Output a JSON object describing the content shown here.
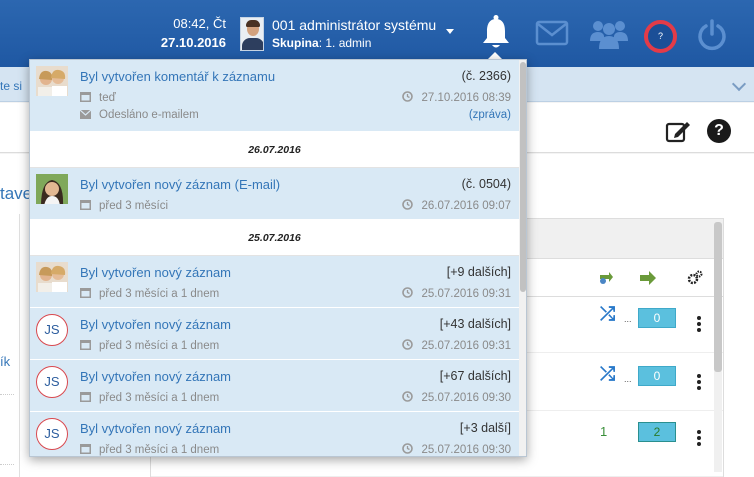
{
  "header": {
    "time": "08:42, Čt",
    "date": "27.10.2016",
    "user_name": "001 administrátor systému",
    "group_label": "Skupina",
    "group_value": ": 1. admin",
    "help_label": "?"
  },
  "subbar": {
    "text": "te si"
  },
  "toolbar": {
    "help_label": "?"
  },
  "content": {
    "heading": "tave",
    "left_link": "ík",
    "rows": [
      {
        "badge": "0",
        "count": ""
      },
      {
        "badge": "0",
        "count": ""
      },
      {
        "badge": "2",
        "count": "1"
      }
    ],
    "ellipsis": "..."
  },
  "notifications": {
    "first": {
      "title": "Byl vytvořen komentář k záznamu",
      "ref": "(č. 2366)",
      "when": "teď",
      "timestamp": "27.10.2016 08:39",
      "extra": "Odesláno e-mailem",
      "link": "(zpráva)"
    },
    "groups": [
      {
        "date": "26.07.2016",
        "items": [
          {
            "title": "Byl vytvořen nový záznam (E-mail)",
            "ref": "(č. 0504)",
            "when": "před 3 měsíci",
            "timestamp": "26.07.2016 09:07",
            "avatar": "photo-woman"
          }
        ]
      },
      {
        "date": "25.07.2016",
        "items": [
          {
            "title": "Byl vytvořen nový záznam",
            "ref": "[+9 dalších]",
            "when": "před 3 měsíci a 1 dnem",
            "timestamp": "25.07.2016 09:31",
            "avatar": "photo-pair"
          },
          {
            "title": "Byl vytvořen nový záznam",
            "ref": "[+43 dalších]",
            "when": "před 3 měsíci a 1 dnem",
            "timestamp": "25.07.2016 09:31",
            "avatar": "JS"
          },
          {
            "title": "Byl vytvořen nový záznam",
            "ref": "[+67 dalších]",
            "when": "před 3 měsíci a 1 dnem",
            "timestamp": "25.07.2016 09:30",
            "avatar": "JS"
          },
          {
            "title": "Byl vytvořen nový záznam",
            "ref": "[+3 další]",
            "when": "před 3 měsíci a 1 dnem",
            "timestamp": "25.07.2016 09:30",
            "avatar": "JS"
          }
        ]
      }
    ]
  },
  "colors": {
    "topbar": "#1f58a3",
    "accent": "#3476b8",
    "notif_bg": "#d9e9f5",
    "help_ring": "#e33b48"
  }
}
